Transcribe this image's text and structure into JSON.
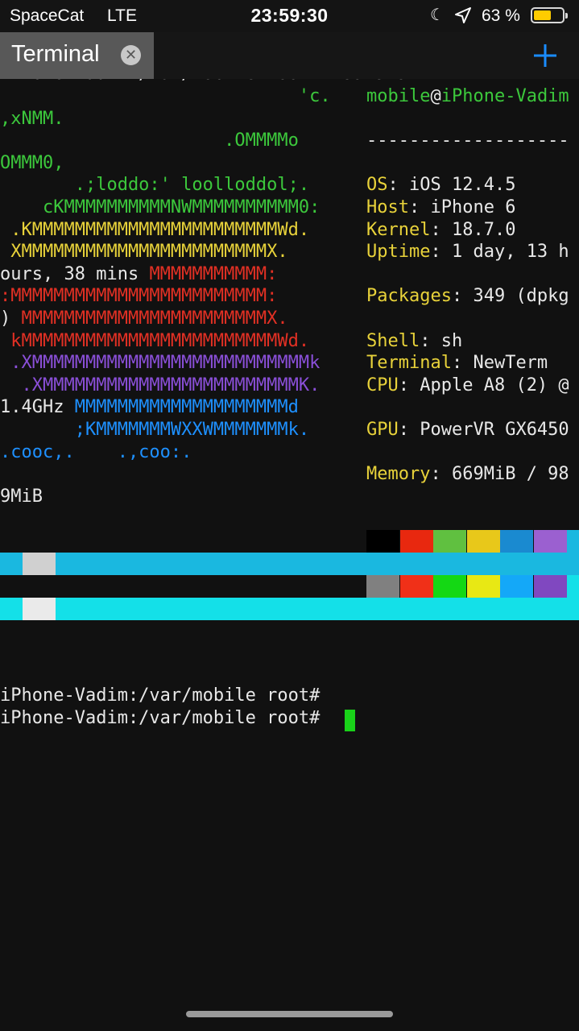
{
  "status_bar": {
    "carrier": "SpaceCat",
    "network": "LTE",
    "time": "23:59:30",
    "battery_percent": "63 %",
    "battery_level": 0.63,
    "icons": [
      "moon-icon",
      "location-arrow-icon",
      "battery-icon"
    ]
  },
  "tabs": {
    "active_label": "Terminal",
    "close_icon": "close-icon",
    "new_tab_icon": "plus-icon"
  },
  "terminal": {
    "cut_top_line": "iPhone-Vadim:/var/mobile root# neofetch",
    "art_lines": [
      [
        {
          "t": "                            'c.",
          "c": "g"
        }
      ],
      [
        {
          "t": ",xNMM.",
          "c": "g"
        }
      ],
      [
        {
          "t": "                     .OMMMMo",
          "c": "g"
        }
      ],
      [
        {
          "t": "OMMM0,",
          "c": "g"
        }
      ],
      [
        {
          "t": "       .;loddo:' loolloddol;.",
          "c": "g"
        }
      ],
      [
        {
          "t": "    cKMMMMMMMMMMNWMMMMMMMMMM0:",
          "c": "g"
        }
      ],
      [
        {
          "t": " .KMMMMMMMMMMMMMMMMMMMMMMMWd.",
          "c": "y"
        }
      ],
      [
        {
          "t": " XMMMMMMMMMMMMMMMMMMMMMMMX.",
          "c": "y"
        }
      ],
      [
        {
          "t": "ours, 38 mins ",
          "c": "w"
        },
        {
          "t": "MMMMMMMMMMM:",
          "c": "r"
        }
      ],
      [
        {
          "t": ":MMMMMMMMMMMMMMMMMMMMMMMM:",
          "c": "r"
        }
      ],
      [
        {
          "t": ") ",
          "c": "w"
        },
        {
          "t": "MMMMMMMMMMMMMMMMMMMMMMMX.",
          "c": "r"
        }
      ],
      [
        {
          "t": " kMMMMMMMMMMMMMMMMMMMMMMMMWd.",
          "c": "r"
        }
      ],
      [
        {
          "t": " .XMMMMMMMMMMMMMMMMMMMMMMMMMMk",
          "c": "p"
        }
      ],
      [
        {
          "t": "  .XMMMMMMMMMMMMMMMMMMMMMMMMK.",
          "c": "p"
        }
      ],
      [
        {
          "t": "1.4GHz ",
          "c": "w"
        },
        {
          "t": "MMMMMMMMMMMMMMMMMMMMd",
          "c": "b"
        }
      ],
      [
        {
          "t": "       ;KMMMMMMMWXXWMMMMMMMk.",
          "c": "b"
        }
      ],
      [
        {
          "t": ".cooc,.    .,coo:.",
          "c": "b"
        }
      ],
      [],
      [
        {
          "t": "9MiB",
          "c": "w"
        }
      ]
    ],
    "info_lines": [
      [
        {
          "t": "mobile",
          "c": "g"
        },
        {
          "t": "@",
          "c": "w"
        },
        {
          "t": "iPhone-Vadim",
          "c": "g"
        }
      ],
      [],
      [
        {
          "t": "-------------------",
          "c": "w"
        }
      ],
      [],
      [
        {
          "t": "OS",
          "c": "y"
        },
        {
          "t": ": iOS 12.4.5",
          "c": "w"
        }
      ],
      [
        {
          "t": "Host",
          "c": "y"
        },
        {
          "t": ": iPhone 6",
          "c": "w"
        }
      ],
      [
        {
          "t": "Kernel",
          "c": "y"
        },
        {
          "t": ": 18.7.0",
          "c": "w"
        }
      ],
      [
        {
          "t": "Uptime",
          "c": "y"
        },
        {
          "t": ": 1 day, 13 h",
          "c": "w"
        }
      ],
      [],
      [
        {
          "t": "Packages",
          "c": "y"
        },
        {
          "t": ": 349 (dpkg",
          "c": "w"
        }
      ],
      [],
      [
        {
          "t": "Shell",
          "c": "y"
        },
        {
          "t": ": sh",
          "c": "w"
        }
      ],
      [
        {
          "t": "Terminal",
          "c": "y"
        },
        {
          "t": ": NewTerm",
          "c": "w"
        }
      ],
      [
        {
          "t": "CPU",
          "c": "y"
        },
        {
          "t": ": Apple A8 (2) @",
          "c": "w"
        }
      ],
      [],
      [
        {
          "t": "GPU",
          "c": "y"
        },
        {
          "t": ": PowerVR GX6450",
          "c": "w"
        }
      ],
      [],
      [
        {
          "t": "Memory",
          "c": "y"
        },
        {
          "t": ": 669MiB / 98",
          "c": "w"
        }
      ]
    ],
    "palette_normal": [
      "#000000",
      "#e8280f",
      "#60c040",
      "#e8c81a",
      "#1a8ad0",
      "#9b60d0",
      "#1ab8e0",
      "#d0d0d0"
    ],
    "palette_bright": [
      "#808080",
      "#f03018",
      "#14d814",
      "#e8e814",
      "#14a8f8",
      "#8048c0",
      "#14e0e8",
      "#eaeaea"
    ],
    "prompts": [
      "iPhone-Vadim:/var/mobile root#",
      "iPhone-Vadim:/var/mobile root# "
    ],
    "cursor_color": "#19d219"
  }
}
